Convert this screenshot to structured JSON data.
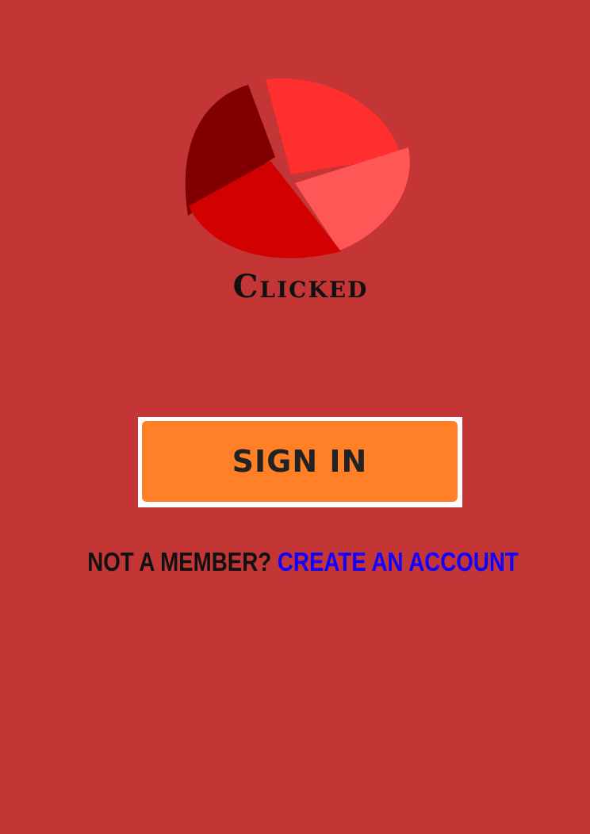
{
  "brand": {
    "name": "Clicked",
    "logo_icon": "pie-chart-icon"
  },
  "auth": {
    "sign_in_label": "SIGN IN",
    "member_prompt": "NOT A MEMBER?",
    "create_account_label": "CREATE AN ACCOUNT"
  },
  "colors": {
    "background": "#c43535",
    "button": "#ff8026",
    "link": "#1100ff",
    "logo_dark": "#800000",
    "logo_bright": "#ff2f2f",
    "logo_light": "#ff5656",
    "logo_mid": "#d20000"
  }
}
